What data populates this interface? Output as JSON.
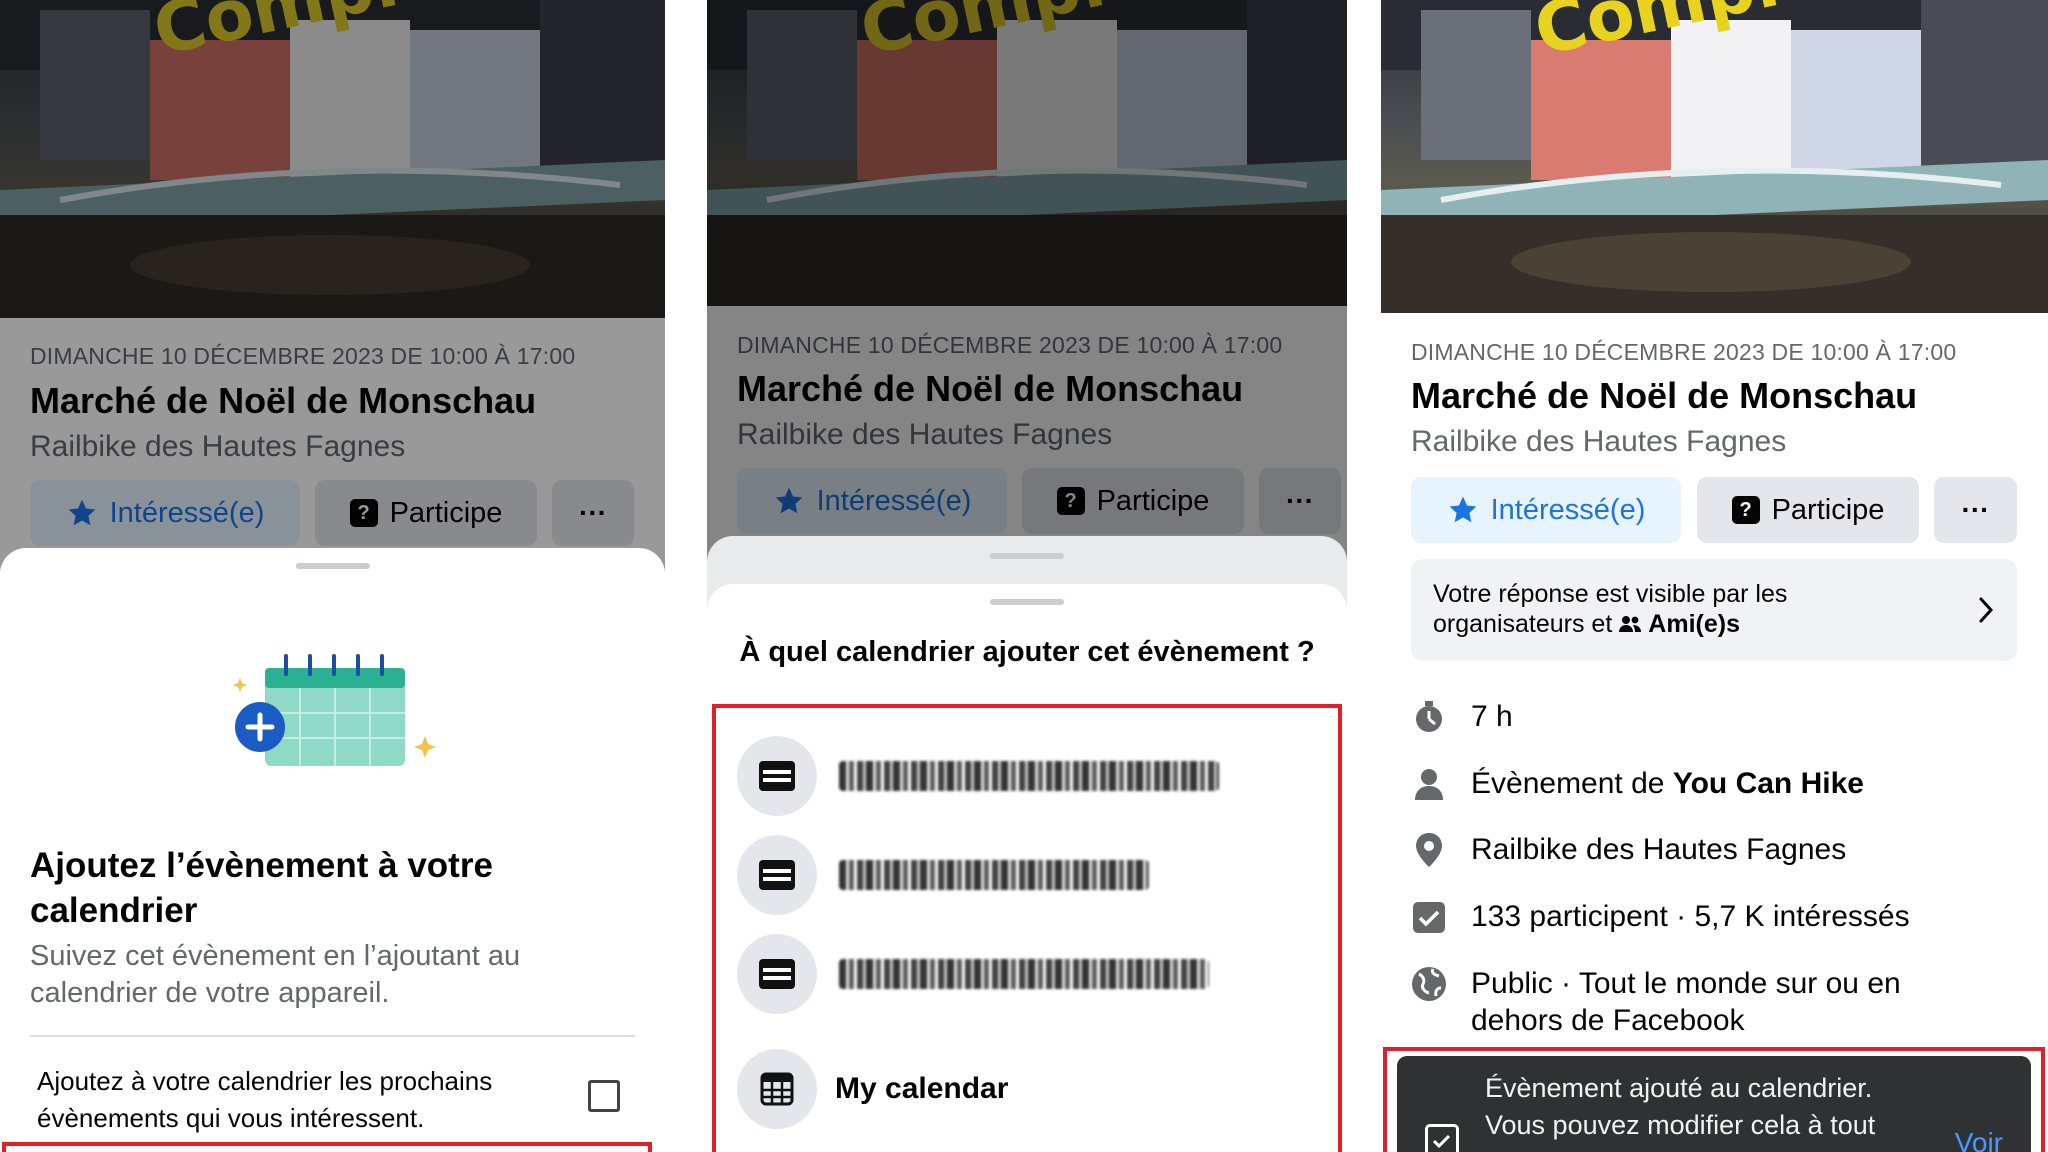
{
  "event": {
    "date": "DIMANCHE 10 DÉCEMBRE 2023 DE 10:00 À 17:00",
    "title": "Marché de Noël de Monschau",
    "place": "Railbike des Hautes Fagnes",
    "photo_overlay_text": "Compl",
    "interested_label": "Intéressé(e)",
    "going_label": "Participe",
    "more_label": "···"
  },
  "panel1": {
    "sheet_title": "Ajoutez l’évènement à votre calendrier",
    "sheet_subtitle": "Suivez cet évènement en l’ajoutant au calendrier de votre appareil.",
    "option_label": "Ajoutez à votre calendrier les prochains évènements qui vous intéressent.",
    "option_checked": false
  },
  "panel2": {
    "question": "À quel calendrier ajouter cet évènement ?",
    "calendars": [
      {
        "icon": "calendar-list-icon",
        "label": ""
      },
      {
        "icon": "calendar-list-icon",
        "label": ""
      },
      {
        "icon": "calendar-list-icon",
        "label": ""
      },
      {
        "icon": "calendar-grid-icon",
        "label": "My calendar"
      }
    ]
  },
  "panel3": {
    "visibility_line1": "Votre réponse est visible par les",
    "visibility_line2": "organisateurs et",
    "visibility_audience": "Ami(e)s",
    "duration": "7 h",
    "organizer_prefix": "Évènement de",
    "organizer_name": "You Can Hike",
    "location": "Railbike des Hautes Fagnes",
    "stats": "133 participent · 5,7 K intéressés",
    "privacy_line1": "Public · Tout le monde sur ou en",
    "privacy_line2": "dehors de Facebook",
    "toast_line1": "Évènement ajouté au calendrier.",
    "toast_line2": "Vous pouvez modifier cela à tout",
    "toast_action": "Voir"
  },
  "colors": {
    "accent_blue": "#1b74e4",
    "highlight_red": "#e0212a",
    "button_gray": "#e4e6eb",
    "secondary_text": "#65676b"
  }
}
